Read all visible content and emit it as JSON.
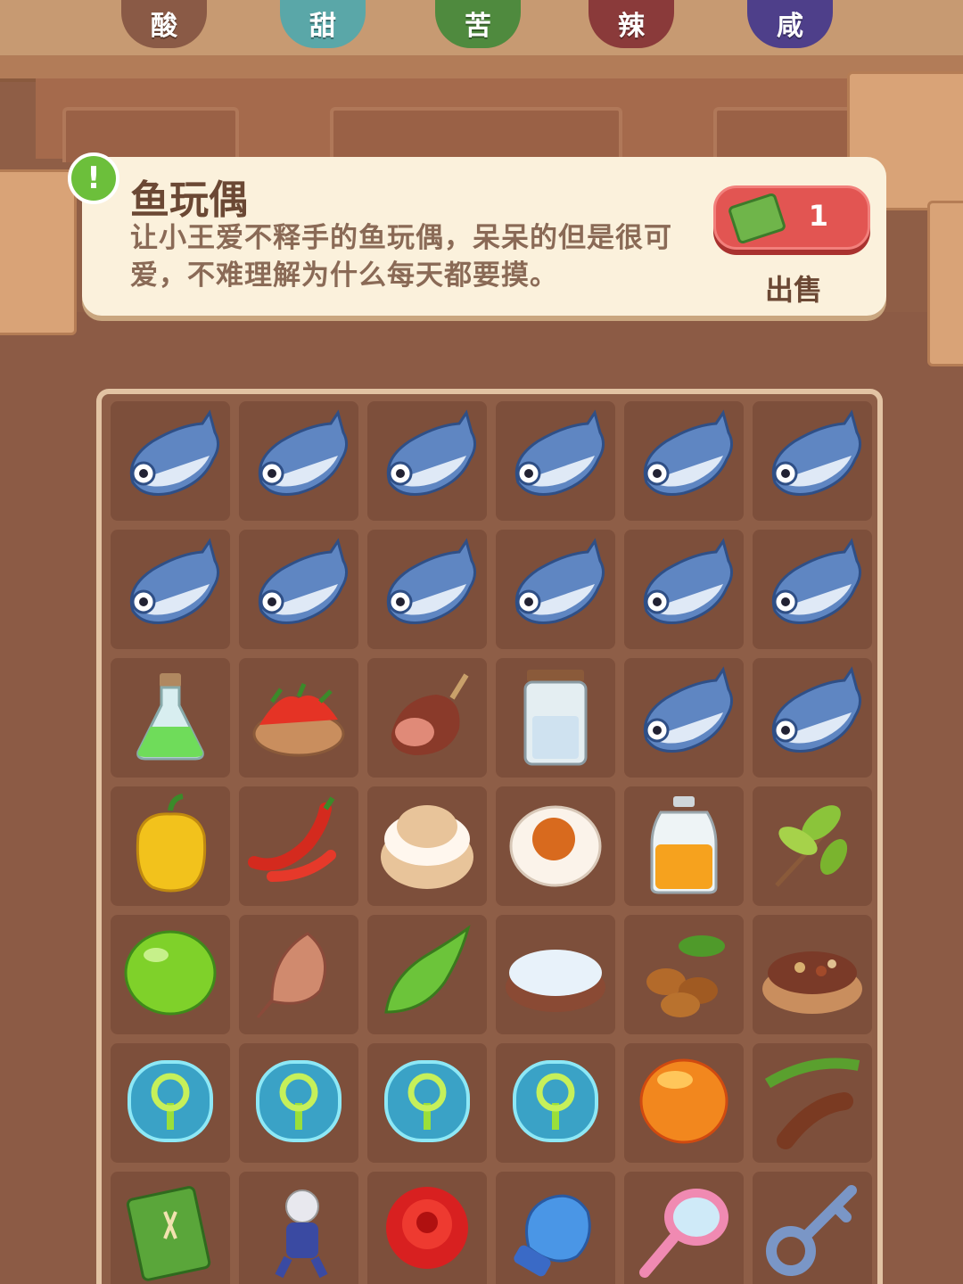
{
  "flavor_jars": [
    {
      "label": "酸",
      "color": "#8a5a46"
    },
    {
      "label": "甜",
      "color": "#5aa7a8"
    },
    {
      "label": "苦",
      "color": "#4f8a3e"
    },
    {
      "label": "辣",
      "color": "#8a3a3a"
    },
    {
      "label": "咸",
      "color": "#4e3f8a"
    }
  ],
  "info_panel": {
    "title": "鱼玩偶",
    "description": "让小王爱不释手的鱼玩偶，呆呆的但是很可爱，不难理解为什么每天都要摸。",
    "sell_price": "1",
    "sell_label": "出售"
  },
  "grid": [
    [
      "fish-icon",
      "fish-icon",
      "fish-icon",
      "fish-icon",
      "fish-icon",
      "fish-icon"
    ],
    [
      "fish-icon",
      "fish-icon",
      "fish-icon",
      "fish-icon",
      "fish-icon",
      "fish-icon"
    ],
    [
      "green-potion-icon",
      "chili-bowl-icon",
      "ham-icon",
      "salt-jar-icon",
      "fish-icon",
      "fish-icon"
    ],
    [
      "bell-pepper-icon",
      "red-chili-icon",
      "cream-puff-icon",
      "salted-egg-icon",
      "honey-jar-icon",
      "tea-leaves-icon"
    ],
    [
      "lime-icon",
      "dried-fish-icon",
      "bitter-melon-icon",
      "salt-bowl-icon",
      "coffee-beans-icon",
      "spice-bowl-icon"
    ],
    [
      "sprout-bubble-icon",
      "sprout-bubble-icon",
      "sprout-bubble-icon",
      "sprout-bubble-icon",
      "orange-orb-icon",
      "tamarind-icon"
    ],
    [
      "notebook-icon",
      "hero-figure-icon",
      "rose-icon",
      "mitten-icon",
      "hand-mirror-icon",
      "key-icon"
    ]
  ],
  "colors": {
    "panel_bg": "#fbf1dc",
    "sell_button": "#e25552",
    "alert": "#6cbf3b",
    "board_bg": "#8e5e47",
    "cell_bg": "#7d4f3b"
  }
}
